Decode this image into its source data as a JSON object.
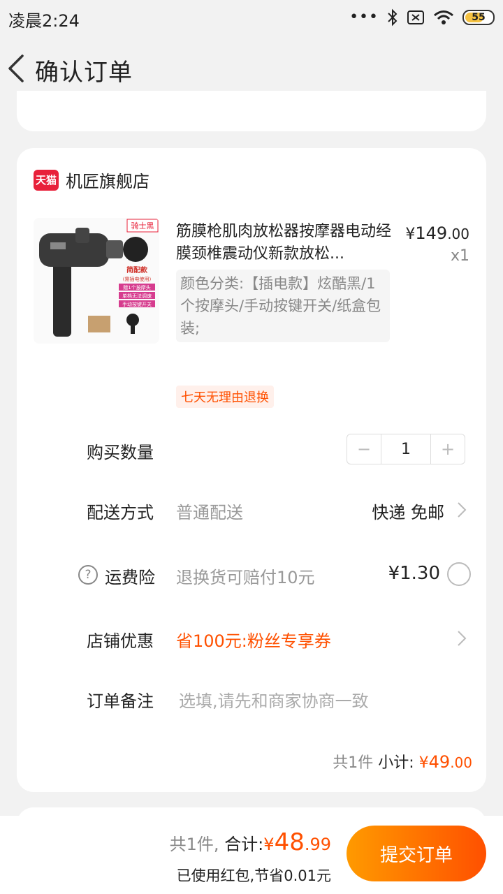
{
  "status_bar": {
    "time": "凌晨2:24",
    "battery": "55"
  },
  "header": {
    "title": "确认订单"
  },
  "shop": {
    "badge": "天猫",
    "name": "机匠旗舰店"
  },
  "product": {
    "image_tag": "骑士黑",
    "image_caption": "简配款",
    "image_subcaption": "(需插电使用)",
    "image_features": [
      "赠1个按摩头",
      "单档无法调速",
      "手动按键开关"
    ],
    "title": "筋膜枪肌肉放松器按摩器电动经膜颈椎震动仪新款放松...",
    "price_symbol": "¥",
    "price_int": "149",
    "price_dec": ".00",
    "quantity_label": "x1",
    "sku": "颜色分类:【插电款】炫酷黑/1个按摩头/手动按键开关/纸盒包装;",
    "return_tag": "七天无理由退换"
  },
  "rows": {
    "quantity": {
      "label": "购买数量",
      "value": "1",
      "minus": "−",
      "plus": "+"
    },
    "delivery": {
      "label": "配送方式",
      "sub": "普通配送",
      "value": "快递 免邮"
    },
    "insurance": {
      "label": "运费险",
      "sub": "退换货可赔付10元",
      "value": "¥1.30"
    },
    "coupon": {
      "label": "店铺优惠",
      "value": "省100元:粉丝专享券"
    },
    "note": {
      "label": "订单备注",
      "placeholder": "选填,请先和商家协商一致"
    }
  },
  "subtotal": {
    "count": "共1件",
    "label": "小计:",
    "symbol": "¥",
    "int": "49",
    "dec": ".00"
  },
  "footer": {
    "count": "共1件,",
    "total_label": "合计:",
    "symbol": "¥",
    "total_int": "48",
    "total_dec": ".99",
    "saved": "已使用红包,节省0.01元",
    "submit": "提交订单"
  },
  "colors": {
    "accent": "#ff5000",
    "tmall": "#e8213a"
  }
}
